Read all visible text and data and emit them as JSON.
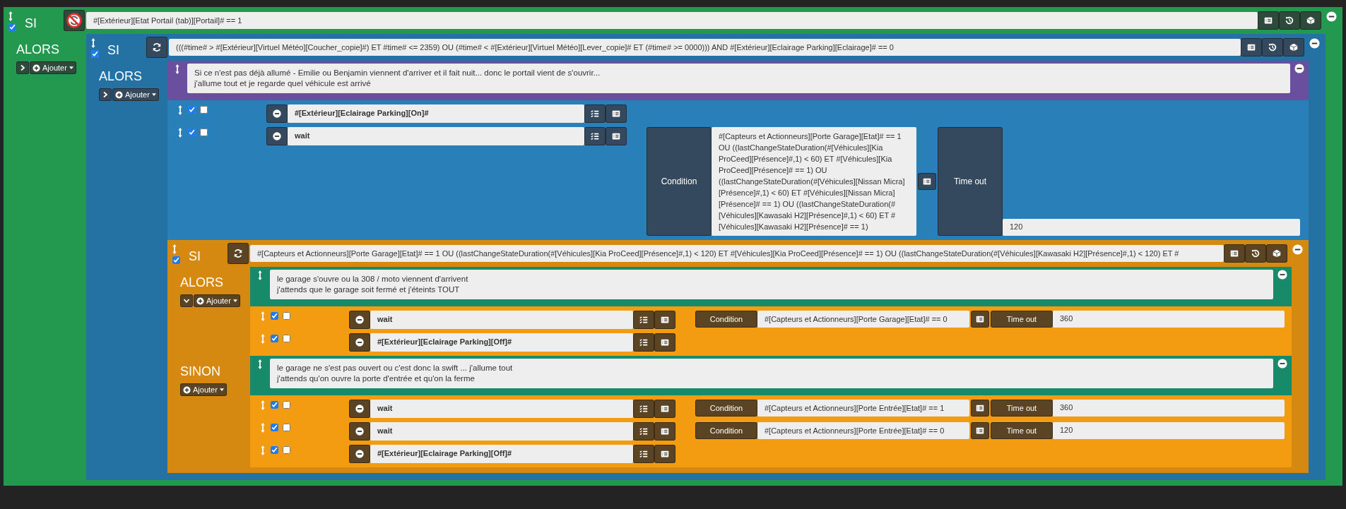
{
  "scenario": {
    "kind": "if",
    "enabled": true,
    "repeat": false,
    "keyword": "SI",
    "condition": "#[Extérieur][Etat Portail (tab)][Portail]# == 1",
    "sections": [
      {
        "label": "ALORS",
        "expanded": false,
        "add_label": "Ajouter",
        "items": [
          {
            "kind": "if",
            "enabled": true,
            "repeat": true,
            "keyword": "SI",
            "condition": "(((#time# > #[Extérieur][Virtuel Météo][Coucher_copie]#) ET #time# <= 2359) OU (#time# < #[Extérieur][Virtuel Météo][Lever_copie]# ET (#time# >= 0000))) AND #[Extérieur][Eclairage Parking][Eclairage]# == 0",
            "sections": [
              {
                "label": "ALORS",
                "expanded": false,
                "add_label": "Ajouter",
                "items": [
                  {
                    "kind": "comment",
                    "text": "Si ce n'est pas déjà allumé - Emilie ou Benjamin viennent d'arriver et il fait nuit... donc le portail vient de s'ouvrir...\nj'allume tout et je regarde quel véhicule est arrivé"
                  },
                  {
                    "kind": "action",
                    "enabled": true,
                    "parallel": false,
                    "command": "#[Extérieur][Eclairage Parking][On]#"
                  },
                  {
                    "kind": "action",
                    "enabled": true,
                    "parallel": false,
                    "command": "wait",
                    "condition_label": "Condition",
                    "condition": "#[Capteurs et Actionneurs][Porte Garage][Etat]# == 1 OU ((lastChangeStateDuration(#[Véhicules][Kia ProCeed][Présence]#,1) < 60) ET #[Véhicules][Kia ProCeed][Présence]# == 1) OU ((lastChangeStateDuration(#[Véhicules][Nissan Micra][Présence]#,1) < 60) ET #[Véhicules][Nissan Micra][Présence]# == 1) OU ((lastChangeStateDuration(#[Véhicules][Kawasaki H2][Présence]#,1) < 60) ET #[Véhicules][Kawasaki H2][Présence]# == 1)",
                    "timeout_label": "Time out",
                    "timeout": "120"
                  },
                  {
                    "kind": "if",
                    "enabled": true,
                    "repeat": true,
                    "keyword": "SI",
                    "condition": "#[Capteurs et Actionneurs][Porte Garage][Etat]# == 1 OU ((lastChangeStateDuration(#[Véhicules][Kia ProCeed][Présence]#,1) < 120) ET #[Véhicules][Kia ProCeed][Présence]# == 1) OU ((lastChangeStateDuration(#[Véhicules][Kawasaki H2][Présence]#,1) < 120) ET #",
                    "sections": [
                      {
                        "label": "ALORS",
                        "expanded": true,
                        "add_label": "Ajouter",
                        "items": [
                          {
                            "kind": "comment",
                            "text": "le garage s'ouvre ou la 308 / moto viennent d'arrivent\nj'attends que le garage soit fermé et j'éteints TOUT"
                          },
                          {
                            "kind": "action",
                            "enabled": true,
                            "parallel": false,
                            "command": "wait",
                            "condition_label": "Condition",
                            "condition": "#[Capteurs et Actionneurs][Porte Garage][Etat]# == 0",
                            "timeout_label": "Time out",
                            "timeout": "360"
                          },
                          {
                            "kind": "action",
                            "enabled": true,
                            "parallel": false,
                            "command": "#[Extérieur][Eclairage Parking][Off]#"
                          }
                        ]
                      },
                      {
                        "label": "SINON",
                        "add_label": "Ajouter",
                        "items": [
                          {
                            "kind": "comment",
                            "text": "le garage ne s'est pas ouvert ou c'est donc la swift ... j'allume tout\nj'attends qu'on ouvre la porte d'entrée et qu'on la ferme"
                          },
                          {
                            "kind": "action",
                            "enabled": true,
                            "parallel": false,
                            "command": "wait",
                            "condition_label": "Condition",
                            "condition": "#[Capteurs et Actionneurs][Porte Entrée][Etat]# == 1",
                            "timeout_label": "Time out",
                            "timeout": "360"
                          },
                          {
                            "kind": "action",
                            "enabled": true,
                            "parallel": false,
                            "command": "wait",
                            "condition_label": "Condition",
                            "condition": "#[Capteurs et Actionneurs][Porte Entrée][Etat]# == 0",
                            "timeout_label": "Time out",
                            "timeout": "120"
                          },
                          {
                            "kind": "action",
                            "enabled": true,
                            "parallel": false,
                            "command": "#[Extérieur][Eclairage Parking][Off]#"
                          }
                        ]
                      }
                    ]
                  }
                ]
              }
            ]
          }
        ]
      }
    ]
  }
}
